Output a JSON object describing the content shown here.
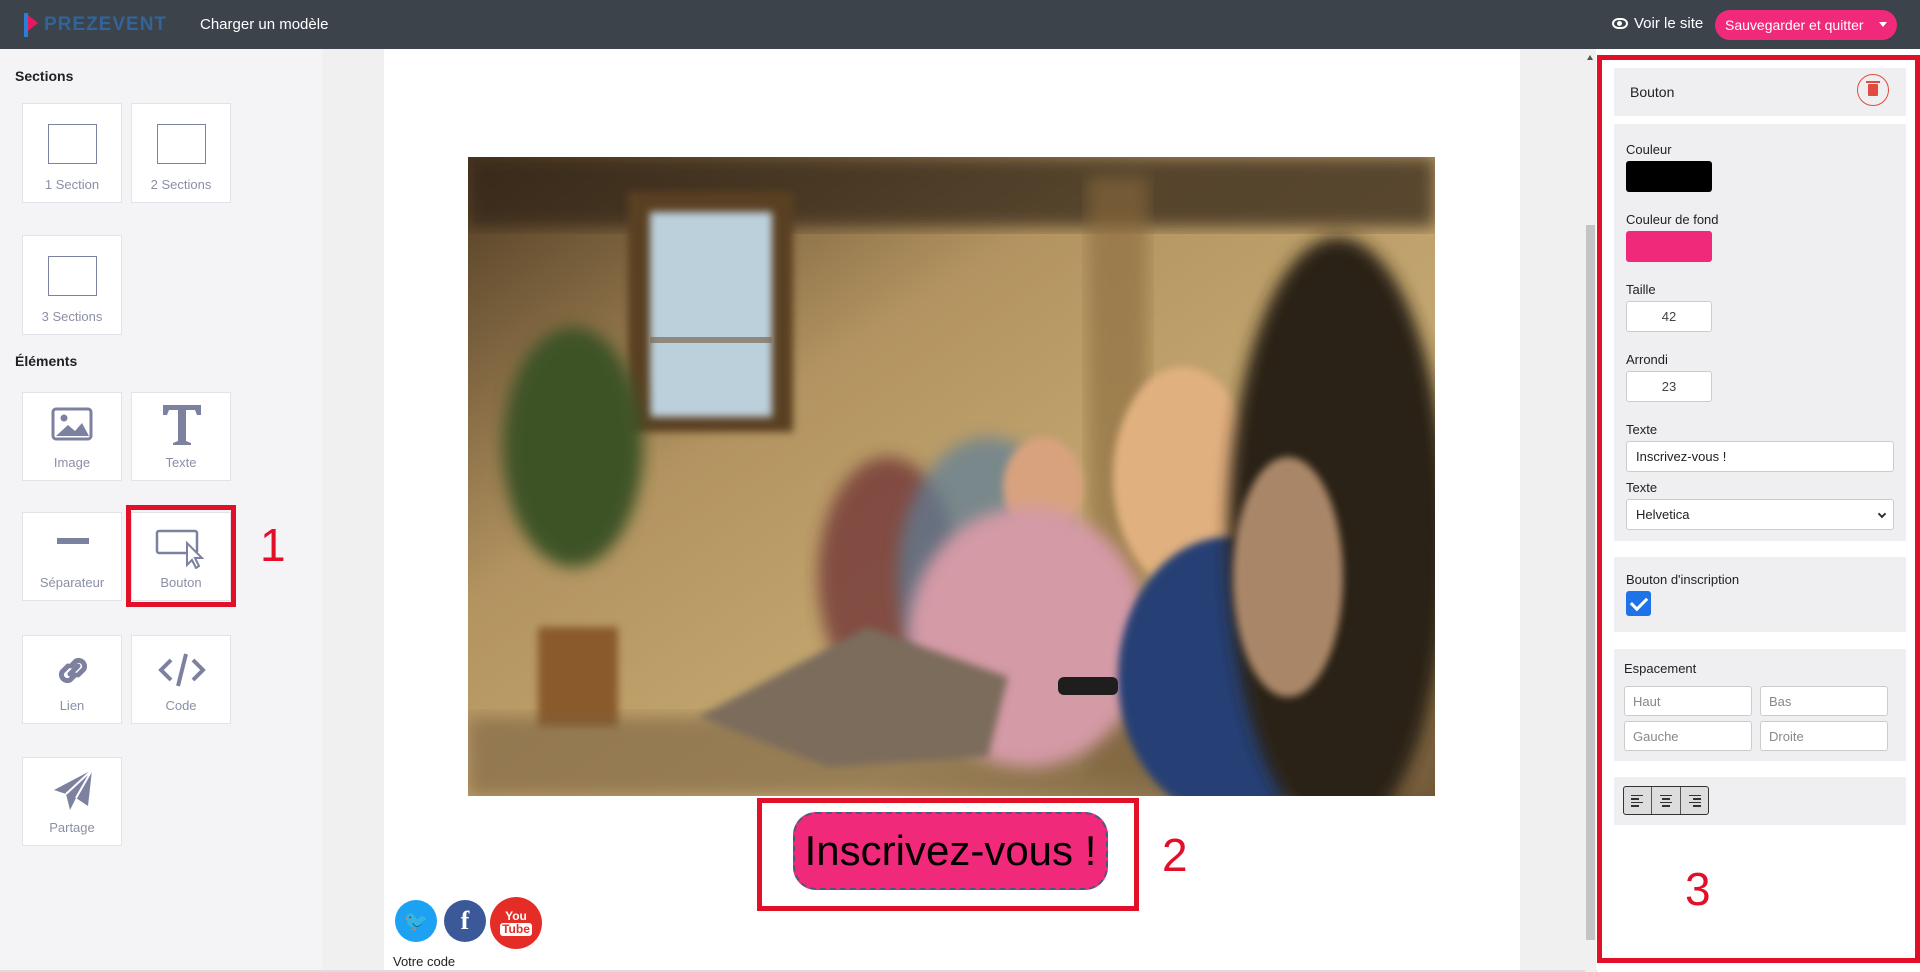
{
  "topbar": {
    "logo_text": "PREZEVENT",
    "load_template": "Charger un modèle",
    "view_site": "Voir le site",
    "save_quit": "Sauvegarder et quitter"
  },
  "sidebar": {
    "sections_heading": "Sections",
    "sections": [
      {
        "label": "1 Section",
        "icon": "one-section-icon"
      },
      {
        "label": "2 Sections",
        "icon": "two-sections-icon"
      },
      {
        "label": "3 Sections",
        "icon": "three-sections-icon"
      }
    ],
    "elements_heading": "Éléments",
    "elements": [
      {
        "label": "Image",
        "icon": "image-icon"
      },
      {
        "label": "Texte",
        "icon": "text-icon"
      },
      {
        "label": "Séparateur",
        "icon": "separator-icon"
      },
      {
        "label": "Bouton",
        "icon": "button-cursor-icon"
      },
      {
        "label": "Lien",
        "icon": "link-icon"
      },
      {
        "label": "Code",
        "icon": "code-icon"
      },
      {
        "label": "Partage",
        "icon": "paper-plane-icon"
      }
    ]
  },
  "annotations": {
    "one": "1",
    "two": "2",
    "three": "3",
    "color": "#e10f27"
  },
  "canvas": {
    "cta_text": "Inscrivez-vous !",
    "social": [
      {
        "name": "twitter",
        "glyph": "🐦"
      },
      {
        "name": "facebook",
        "glyph": "f"
      },
      {
        "name": "youtube",
        "glyph_top": "You",
        "glyph_bottom": "Tube"
      }
    ],
    "code_label": "Votre code"
  },
  "panel": {
    "title": "Bouton",
    "color_label": "Couleur",
    "color_value": "#000000",
    "bg_color_label": "Couleur de fond",
    "bg_color_value": "#f0297a",
    "size_label": "Taille",
    "size_value": "42",
    "radius_label": "Arrondi",
    "radius_value": "23",
    "text_label": "Texte",
    "text_value": "Inscrivez-vous !",
    "font_label": "Texte",
    "font_value": "Helvetica",
    "signup_label": "Bouton d'inscription",
    "signup_checked": true,
    "spacing_label": "Espacement",
    "spacing": {
      "top": "Haut",
      "bottom": "Bas",
      "left": "Gauche",
      "right": "Droite"
    },
    "alignment": [
      "align-left-icon",
      "align-center-icon",
      "align-right-icon"
    ]
  },
  "colors": {
    "accent": "#f0297a",
    "topbar": "#3d434b",
    "checkbox": "#1e73e8"
  }
}
